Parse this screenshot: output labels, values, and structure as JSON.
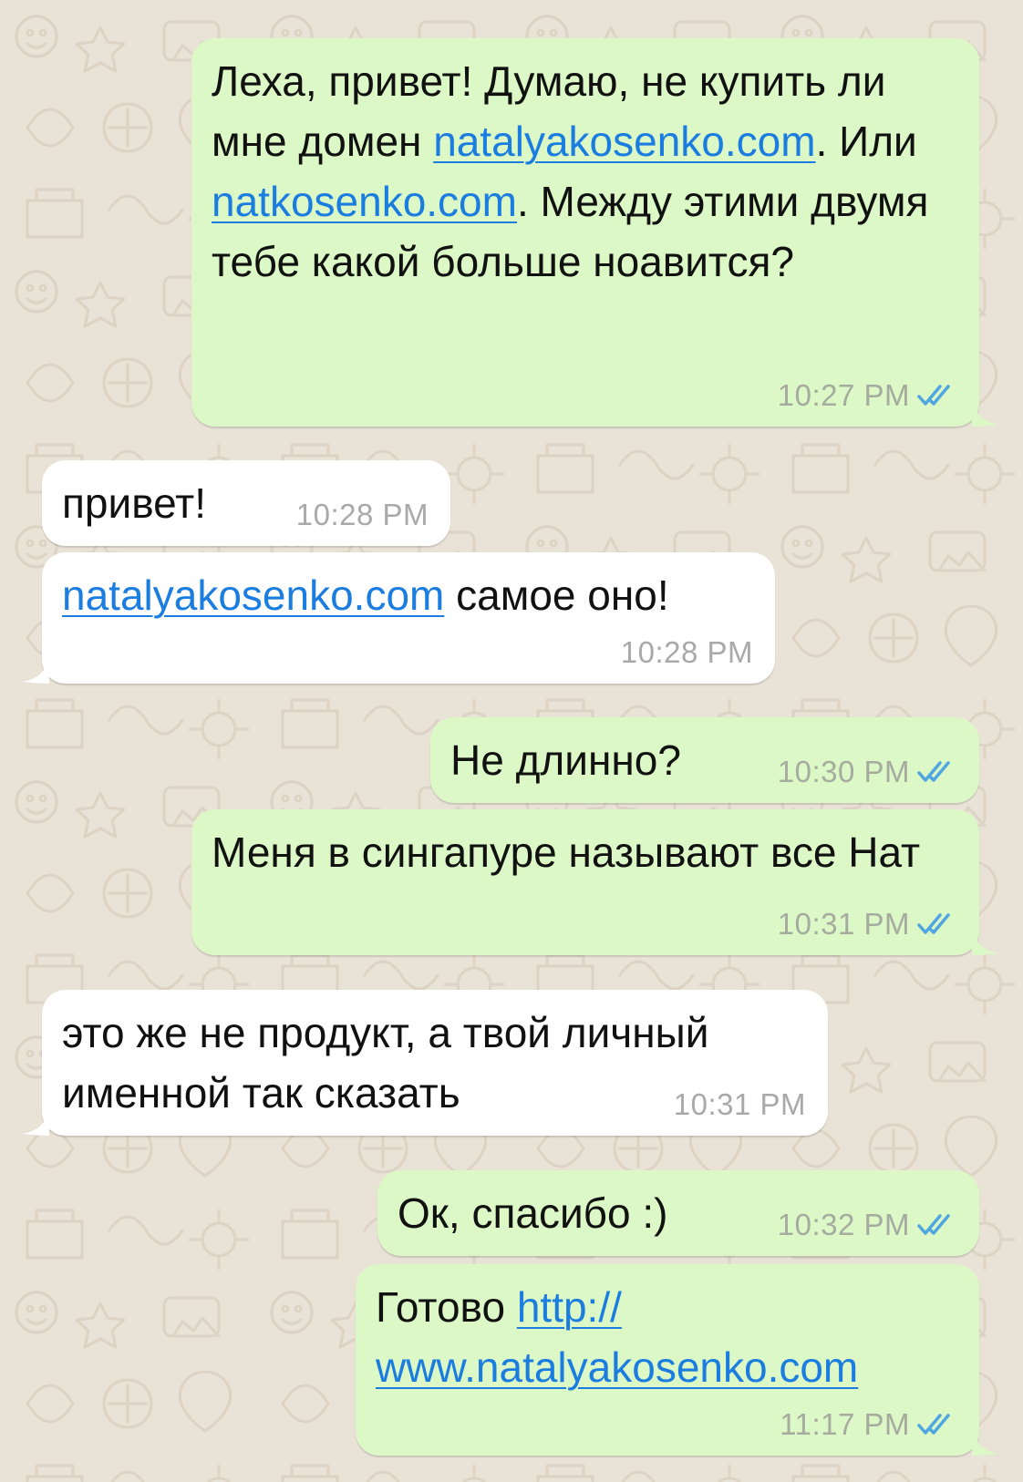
{
  "colors": {
    "background": "#e9e2d6",
    "outgoing_bubble": "#dcf8c6",
    "incoming_bubble": "#ffffff",
    "link": "#1b7de0",
    "read_ticks": "#4fa6e0",
    "timestamp": "#a6ab9f"
  },
  "messages": [
    {
      "direction": "outgoing",
      "text_1": "Леха, привет! Думаю, не купить ли мне домен ",
      "link_1": "natalyakosenko.com",
      "text_2": ". Или ",
      "link_2": "natkosenko.com",
      "text_3": ". Между этими двумя тебе какой больше ноавится?",
      "time": "10:27 PM",
      "status_icon": "double-check-read-icon"
    },
    {
      "direction": "incoming",
      "text": "привет!",
      "time": "10:28 PM"
    },
    {
      "direction": "incoming",
      "link": "natalyakosenko.com",
      "text": " самое оно!",
      "time": "10:28 PM"
    },
    {
      "direction": "outgoing",
      "text": "Не длинно?",
      "time": "10:30 PM",
      "status_icon": "double-check-read-icon"
    },
    {
      "direction": "outgoing",
      "text": "Меня в сингапуре называют все Нат",
      "time": "10:31 PM",
      "status_icon": "double-check-read-icon"
    },
    {
      "direction": "incoming",
      "text": "это же не продукт, а твой личный именной так сказать",
      "time": "10:31 PM"
    },
    {
      "direction": "outgoing",
      "text": "Ок, спасибо :)",
      "time": "10:32 PM",
      "status_icon": "double-check-read-icon"
    },
    {
      "direction": "outgoing",
      "text": "Готово ",
      "link_1": "http://",
      "link_2": "www.natalyakosenko.com",
      "time": "11:17 PM",
      "status_icon": "double-check-read-icon"
    }
  ]
}
